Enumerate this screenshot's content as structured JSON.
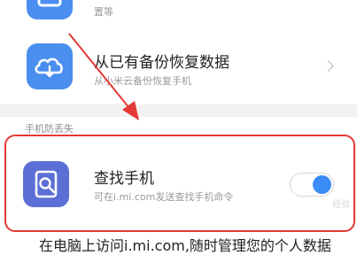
{
  "colors": {
    "accent_blue": "#4a8ef0",
    "find_phone_tile": "#5b6fd6",
    "highlight_red": "#e53935",
    "toggle_on": "#3b8cf7"
  },
  "top_item": {
    "subtitle_fragment": "置等",
    "icon": "settings-tile-icon"
  },
  "restore_item": {
    "title": "从已有备份恢复数据",
    "subtitle": "从小米云备份恢复手机",
    "icon": "cloud-restore-icon",
    "chevron": "chevron-right-icon"
  },
  "section": {
    "label": "手机防丢失"
  },
  "find_phone_item": {
    "title": "查找手机",
    "subtitle": "可在i.mi.com发送查找手机命令",
    "icon": "find-phone-icon",
    "toggle_on": true
  },
  "footer": {
    "text": "在电脑上访问i.mi.com,随时管理您的个人数据"
  },
  "watermark": {
    "text": "经验"
  }
}
